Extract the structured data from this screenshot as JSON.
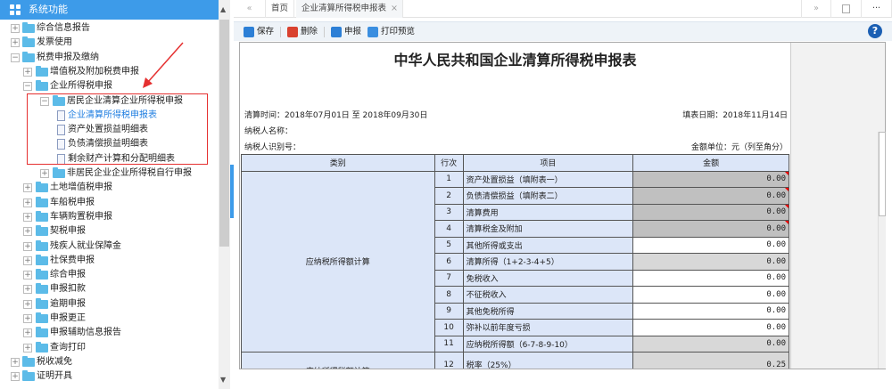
{
  "sidebar": {
    "title": "系统功能",
    "items": [
      {
        "label": "综合信息报告",
        "level": 0,
        "type": "folder",
        "state": "+"
      },
      {
        "label": "发票使用",
        "level": 0,
        "type": "folder",
        "state": "+"
      },
      {
        "label": "税费申报及缴纳",
        "level": 0,
        "type": "folder",
        "state": "-"
      },
      {
        "label": "增值税及附加税费申报",
        "level": 1,
        "type": "folder",
        "state": "+"
      },
      {
        "label": "企业所得税申报",
        "level": 1,
        "type": "folder",
        "state": "-"
      },
      {
        "label": "居民企业清算企业所得税申报",
        "level": 2,
        "type": "folder",
        "state": "-"
      },
      {
        "label": "企业清算所得税申报表",
        "level": 3,
        "type": "doc",
        "active": true
      },
      {
        "label": "资产处置损益明细表",
        "level": 3,
        "type": "doc"
      },
      {
        "label": "负债清偿损益明细表",
        "level": 3,
        "type": "doc"
      },
      {
        "label": "剩余财产计算和分配明细表",
        "level": 3,
        "type": "doc"
      },
      {
        "label": "非居民企业企业所得税自行申报",
        "level": 2,
        "type": "folder",
        "state": "+"
      },
      {
        "label": "土地增值税申报",
        "level": 1,
        "type": "folder",
        "state": "+"
      },
      {
        "label": "车船税申报",
        "level": 1,
        "type": "folder",
        "state": "+"
      },
      {
        "label": "车辆购置税申报",
        "level": 1,
        "type": "folder",
        "state": "+"
      },
      {
        "label": "契税申报",
        "level": 1,
        "type": "folder",
        "state": "+"
      },
      {
        "label": "残疾人就业保障金",
        "level": 1,
        "type": "folder",
        "state": "+"
      },
      {
        "label": "社保费申报",
        "level": 1,
        "type": "folder",
        "state": "+"
      },
      {
        "label": "综合申报",
        "level": 1,
        "type": "folder",
        "state": "+"
      },
      {
        "label": "申报扣款",
        "level": 1,
        "type": "folder",
        "state": "+"
      },
      {
        "label": "逾期申报",
        "level": 1,
        "type": "folder",
        "state": "+"
      },
      {
        "label": "申报更正",
        "level": 1,
        "type": "folder",
        "state": "+"
      },
      {
        "label": "申报辅助信息报告",
        "level": 1,
        "type": "folder",
        "state": "+"
      },
      {
        "label": "查询打印",
        "level": 1,
        "type": "folder",
        "state": "+"
      },
      {
        "label": "税收减免",
        "level": 0,
        "type": "folder",
        "state": "+"
      },
      {
        "label": "证明开具",
        "level": 0,
        "type": "folder",
        "state": "+"
      }
    ]
  },
  "tabs": {
    "prev": "«",
    "home": "首页",
    "current": "企业清算所得税申报表",
    "close": "×",
    "next": "»",
    "more": "···"
  },
  "toolbar": {
    "save": "保存",
    "delete": "删除",
    "submit": "申报",
    "print_preview": "打印预览",
    "help": "?"
  },
  "form": {
    "title": "中华人民共和国企业清算所得税申报表",
    "period": "清算时间：2018年07月01日 至 2018年09月30日",
    "fill_date": "填表日期：2018年11月14日",
    "taxpayer_name": "纳税人名称：",
    "taxpayer_id": "纳税人识别号：",
    "unit": "金额单位：元（列至角分）",
    "headers": [
      "类别",
      "行次",
      "项目",
      "金额"
    ],
    "category1": "应纳税所得额计算",
    "category2": "应纳所得税额计算",
    "rows": [
      {
        "no": "1",
        "item": "资产处置损益（填附表一）",
        "amount": "0.00",
        "style": "g1",
        "flag": true
      },
      {
        "no": "2",
        "item": "负债清偿损益（填附表二）",
        "amount": "0.00",
        "style": "g1",
        "flag": true
      },
      {
        "no": "3",
        "item": "清算费用",
        "amount": "0.00",
        "style": "g1",
        "flag": true
      },
      {
        "no": "4",
        "item": "清算税金及附加",
        "amount": "0.00",
        "style": "g1",
        "flag": true
      },
      {
        "no": "5",
        "item": "其他所得或支出",
        "amount": "0.00",
        "style": "w"
      },
      {
        "no": "6",
        "item": "清算所得（1+2-3-4+5）",
        "amount": "0.00",
        "style": "g2"
      },
      {
        "no": "7",
        "item": "免税收入",
        "amount": "0.00",
        "style": "w"
      },
      {
        "no": "8",
        "item": "不征税收入",
        "amount": "0.00",
        "style": "w"
      },
      {
        "no": "9",
        "item": "其他免税所得",
        "amount": "0.00",
        "style": "w"
      },
      {
        "no": "10",
        "item": "弥补以前年度亏损",
        "amount": "0.00",
        "style": "w"
      },
      {
        "no": "11",
        "item": "应纳税所得额（6-7-8-9-10）",
        "amount": "0.00",
        "style": "g2"
      },
      {
        "no": "12",
        "item": "税率（25%）",
        "amount": "0.25",
        "style": "g2"
      }
    ]
  },
  "colors": {
    "accent": "#3d9be9",
    "highlight_box": "#e53030",
    "header_bg": "#dce6f8"
  }
}
